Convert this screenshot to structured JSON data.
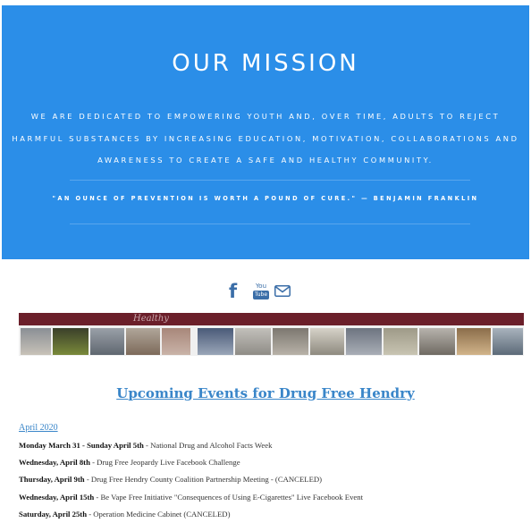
{
  "mission": {
    "title": "OUR MISSION",
    "body": "WE ARE DEDICATED TO EMPOWERING YOUTH AND, OVER TIME, ADULTS TO REJECT HARMFUL SUBSTANCES BY INCREASING EDUCATION, MOTIVATION, COLLABORATIONS AND AWARENESS TO CREATE A SAFE AND HEALTHY COMMUNITY.",
    "quote": "\"AN OUNCE OF PREVENTION IS WORTH A POUND OF CURE.\" — BENJAMIN FRANKLIN",
    "bg_color": "#2b8ee8"
  },
  "social": {
    "facebook": "f",
    "youtube_top": "You",
    "youtube_bottom": "Tube",
    "icons": [
      "facebook-icon",
      "youtube-icon",
      "mail-icon"
    ]
  },
  "banner": {
    "script_text": "Healthy"
  },
  "events": {
    "heading": "Upcoming Events for Drug Free Hendry",
    "month": "April 2020",
    "items": [
      {
        "date": "Monday March 31 - Sunday April 5th",
        "desc": " - National Drug and Alcohol Facts Week"
      },
      {
        "date": "Wednesday, April 8th",
        "desc": " - Drug Free Jeopardy Live Facebook Challenge"
      },
      {
        "date": "Thursday, April 9th",
        "desc": " - Drug Free Hendry County Coalition Partnership Meeting - (CANCELED)"
      },
      {
        "date": "Wednesday, April 15th",
        "desc": " - Be Vape Free Initiative \"Consequences of Using E-Cigarettes\" Live Facebook Event"
      },
      {
        "date": "Saturday, April 25th",
        "desc": " - Operation Medicine Cabinet (CANCELED)"
      }
    ],
    "link_color": "#3a86c9"
  }
}
